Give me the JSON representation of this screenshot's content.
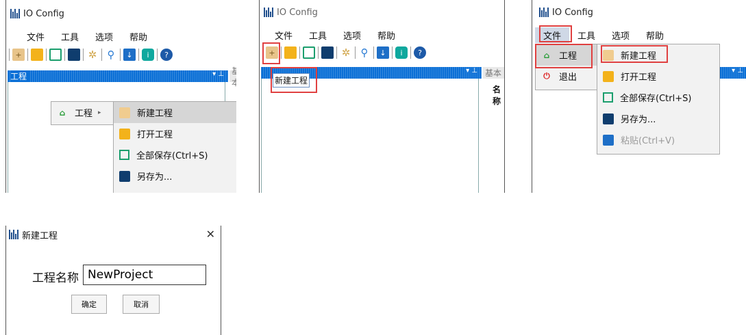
{
  "app": {
    "title": "IO Config"
  },
  "menu": {
    "file": "文件",
    "tools": "工具",
    "options": "选项",
    "help": "帮助"
  },
  "toolbar": {
    "icons": [
      "new-project-icon",
      "open-folder-icon",
      "save-all-icon",
      "save-as-icon",
      "config-gear-icon",
      "search-icon",
      "download-icon",
      "info-icon",
      "help-icon"
    ]
  },
  "panel": {
    "project_tab": "工程",
    "basic_tab": "基本",
    "name_col": "名称",
    "tree_item_new": "新建工程"
  },
  "submenu_project": "工程",
  "submenu_exit": "退出",
  "project_menu": [
    {
      "label": "新建工程",
      "icon": "new-project-icon"
    },
    {
      "label": "打开工程",
      "icon": "open-folder-icon"
    },
    {
      "label": "全部保存(Ctrl+S)",
      "icon": "save-all-icon"
    },
    {
      "label": "另存为...",
      "icon": "save-as-icon"
    },
    {
      "label": "粘贴(Ctrl+V)",
      "icon": "paste-icon"
    }
  ],
  "dialog": {
    "title": "新建工程",
    "name_label": "工程名称",
    "name_value": "NewProject",
    "ok": "确定",
    "cancel": "取消",
    "close_glyph": "✕"
  },
  "colors": {
    "accent": "#0a6fd6",
    "highlight_box": "#e04040"
  }
}
